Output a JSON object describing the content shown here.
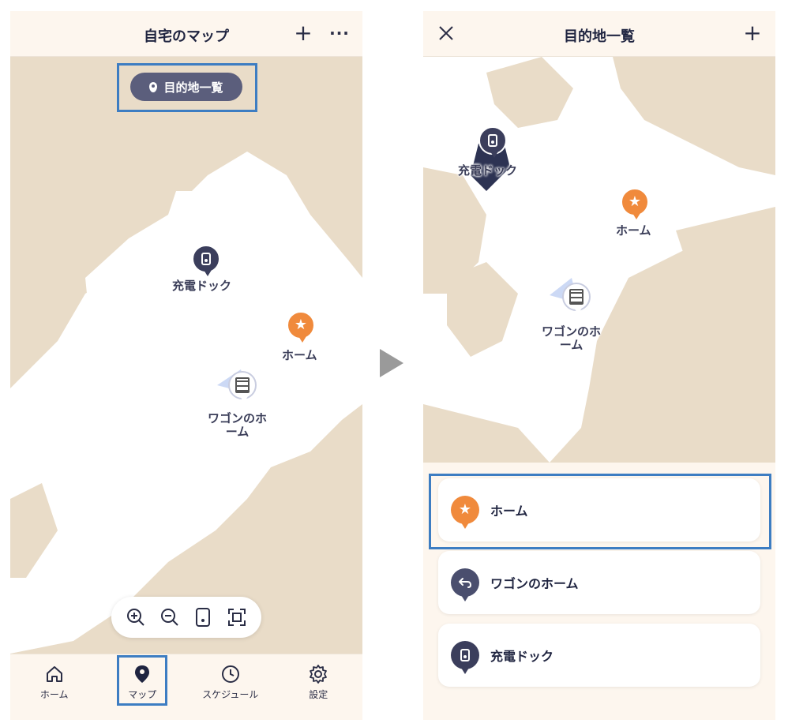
{
  "left_screen": {
    "header": {
      "title": "自宅のマップ",
      "add_icon": "plus-icon",
      "more_icon": "ellipsis-icon"
    },
    "destination_button": {
      "label": "目的地一覧",
      "icon": "location-pin-icon"
    },
    "map_markers": {
      "charging_dock": "充電ドック",
      "home": "ホーム",
      "wagon_home_line1": "ワゴンのホ",
      "wagon_home_line2": "ーム"
    },
    "zoom_controls": [
      "zoom-in-icon",
      "zoom-out-icon",
      "dock-icon",
      "fit-screen-icon"
    ],
    "tabs": [
      {
        "label": "ホーム",
        "icon": "home-icon"
      },
      {
        "label": "マップ",
        "icon": "map-pin-icon"
      },
      {
        "label": "スケジュール",
        "icon": "clock-icon"
      },
      {
        "label": "設定",
        "icon": "gear-icon"
      }
    ],
    "active_tab": "マップ"
  },
  "right_screen": {
    "header": {
      "title": "目的地一覧",
      "close_icon": "close-icon",
      "add_icon": "plus-icon"
    },
    "map_markers": {
      "charging_dock": "充電ドック",
      "home": "ホーム",
      "wagon_home_line1": "ワゴンのホ",
      "wagon_home_line2": "ーム"
    },
    "destinations": [
      {
        "label": "ホーム",
        "icon": "star-icon",
        "color": "#f08a3c"
      },
      {
        "label": "ワゴンのホーム",
        "icon": "return-arrow-icon",
        "color": "#4a4e6e"
      },
      {
        "label": "充電ドック",
        "icon": "dock-icon",
        "color": "#3b3e5c"
      }
    ]
  },
  "colors": {
    "accent_navy": "#3b3e5c",
    "accent_orange": "#f08a3c",
    "highlight_blue": "#3d7dc2",
    "background": "#fdf6ee",
    "map_wall": "#e9dcc8",
    "map_free": "#ffffff"
  }
}
